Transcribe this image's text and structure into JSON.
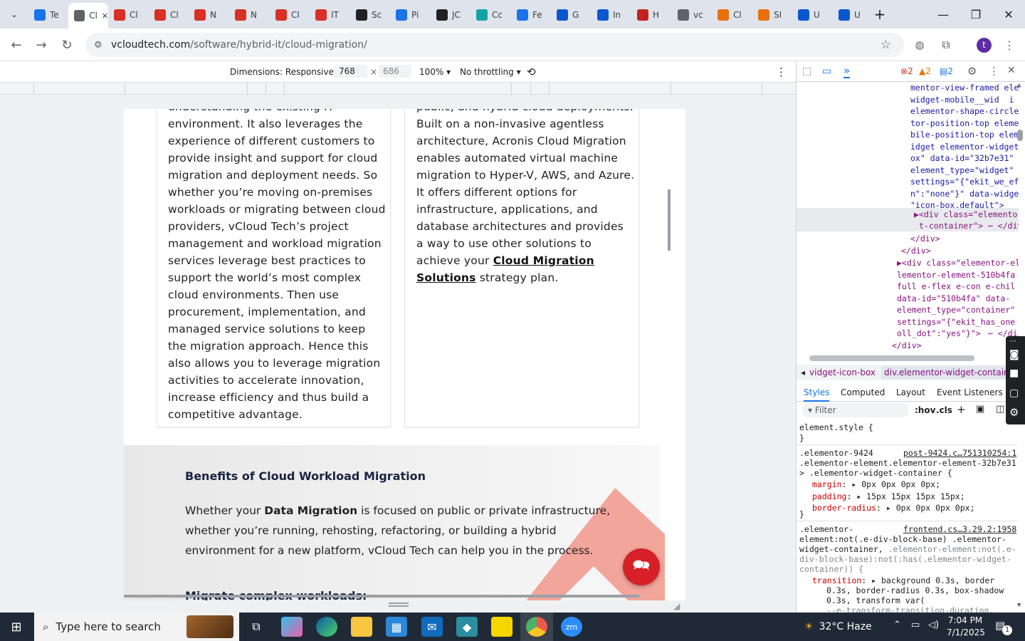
{
  "browser": {
    "tabs": [
      {
        "label": "Te",
        "color": "#1a73e8"
      },
      {
        "label": "Cl",
        "color": "#5f6368",
        "active": true
      },
      {
        "label": "Cl",
        "color": "#d93025"
      },
      {
        "label": "Cl",
        "color": "#d93025"
      },
      {
        "label": "N",
        "color": "#d93025"
      },
      {
        "label": "N",
        "color": "#d93025"
      },
      {
        "label": "Cl",
        "color": "#d93025"
      },
      {
        "label": "IT",
        "color": "#d93025"
      },
      {
        "label": "Sc",
        "color": "#202124"
      },
      {
        "label": "Pi",
        "color": "#1a73e8"
      },
      {
        "label": "JC",
        "color": "#202124"
      },
      {
        "label": "Cc",
        "color": "#12a4a4"
      },
      {
        "label": "Fe",
        "color": "#1a73e8"
      },
      {
        "label": "G",
        "color": "#0b57d0"
      },
      {
        "label": "In",
        "color": "#0b57d0"
      },
      {
        "label": "H",
        "color": "#c5221f"
      },
      {
        "label": "vc",
        "color": "#5f6368"
      },
      {
        "label": "Cl",
        "color": "#e8710a"
      },
      {
        "label": "SI",
        "color": "#e8710a"
      },
      {
        "label": "U",
        "color": "#0b57d0"
      },
      {
        "label": "U",
        "color": "#0b57d0"
      }
    ],
    "url_domain": "vcloudtech.com",
    "url_path": "/software/hybrid-it/cloud-migration/",
    "profile_initial": "t"
  },
  "device_toolbar": {
    "dimensions_label": "Dimensions: Responsive",
    "width": "768",
    "times": "×",
    "height": "686",
    "zoom": "100%",
    "throttling": "No throttling"
  },
  "page": {
    "left_card_lines": [
      "environment. It also leverages the",
      "experience of different customers to",
      "provide insight and support for cloud",
      "migration and deployment needs. So",
      "whether you’re moving on-premises",
      "workloads or migrating between cloud",
      "providers, vCloud Tech’s project",
      "management and workload migration",
      "services leverage best practices to",
      "support the world’s most complex",
      "cloud environments. Then use",
      "procurement, implementation, and",
      "managed service solutions to keep",
      "the migration approach. Hence this",
      "also allows you to leverage migration",
      "activities to accelerate innovation,",
      "increase efficiency and thus build a",
      "competitive advantage."
    ],
    "left_card_cut_line": "understanding the existing IT",
    "right_card_cut_line": "public, and hybrid cloud deployments.",
    "right_card_lines": [
      "Built on a non-invasive agentless",
      "architecture, Acronis Cloud Migration",
      "enables automated virtual machine",
      "migration to Hyper-V, AWS, and Azure.",
      "It offers different options for",
      "infrastructure, applications, and",
      "database architectures and provides",
      "a way to use other solutions to"
    ],
    "right_card_line_pre": "achieve your ",
    "right_card_link1": "Cloud Migration",
    "right_card_link2": "Solutions",
    "right_card_tail": " strategy plan.",
    "benefits_heading": "Benefits of Cloud Workload Migration",
    "benefits_p1_pre": "Whether your ",
    "benefits_p1_bold": "Data Migration",
    "benefits_p1_post": " is focused on public or private infrastructure,",
    "benefits_p2": "whether you’re running, rehosting, refactoring, or building a hybrid",
    "benefits_p3": "environment for a new platform, vCloud Tech can help you in the process.",
    "next_heading": "Migrate complex workloads:"
  },
  "devtools": {
    "errors": "2",
    "warnings": "2",
    "issues": "2",
    "dom_lines": [
      "mentor-view-framed ele",
      "widget-mobile__wid  i",
      "elementor-shape-circle",
      "tor-position-top eleme",
      "bile-position-top elem",
      "idget elementor-widget",
      "ox\" data-id=\"32b7e31\"",
      "element_type=\"widget\"",
      "settings=\"{\"ekit_we_ef",
      "n\":\"none\"}\" data-widge",
      "\"icon-box.default\">"
    ],
    "dom_selected_1": "▶<div class=\"elementor",
    "dom_selected_2": "t-container\">",
    "dom_selected_close": "</div",
    "dom_close1": "</div>",
    "dom_close2": "</div>",
    "dom_div2": [
      "▶<div class=\"elementor-el",
      "lementor-element-510b4fa",
      "full e-flex e-con e-chil",
      "data-id=\"510b4fa\" data-",
      "element_type=\"container\"",
      "settings=\"{\"ekit_has_one",
      "oll_dot\":\"yes\"}\">"
    ],
    "dom_div2_close": "</di",
    "dom_close3": "</div>",
    "breadcrumb1": "vidget-icon-box",
    "breadcrumb2": "div.elementor-widget-container",
    "style_tabs": [
      "Styles",
      "Computed",
      "Layout",
      "Event Listeners"
    ],
    "filter_placeholder": "Filter",
    "hov": ":hov",
    "cls": ".cls",
    "rule1_selector": "element.style {",
    "rule1_close": "}",
    "rule2_sel1": ".elementor-9424",
    "rule2_source": "post-9424.c…751310254:1",
    "rule2_sel2": ".elementor-element.elementor-element-32b7e31",
    "rule2_sel3": "> .elementor-widget-container {",
    "rule2_props": [
      {
        "name": "margin",
        "value": "0px 0px 0px 0px;"
      },
      {
        "name": "padding",
        "value": "15px 15px 15px 15px;"
      },
      {
        "name": "border-radius",
        "value": "0px 0px 0px 0px;"
      }
    ],
    "rule2_close": "}",
    "rule3_sel1": ".elementor-",
    "rule3_source": "frontend.cs…3.29.2:1958",
    "rule3_sel2": "element:not(.e-div-block-base) .elementor-",
    "rule3_sel3": "widget-container,",
    "rule3_sel3b": " .elementor-element:not(.e-",
    "rule3_sel4": "div-block-base):not(:has(.elementor-widget-",
    "rule3_sel5": "container)) {",
    "rule3_prop_name": "transition",
    "rule3_prop_val": "background 0.3s, border",
    "rule3_cont1": "0.3s, border-radius 0.3s, box-shadow",
    "rule3_cont2": "0.3s, transform var(",
    "rule3_cont3": "--e-transform-transition-duration,"
  },
  "taskbar": {
    "search_placeholder": "Type here to search",
    "weather": "32°C  Haze",
    "time": "7:04 PM",
    "date": "7/1/2025",
    "notif_count": "1"
  }
}
